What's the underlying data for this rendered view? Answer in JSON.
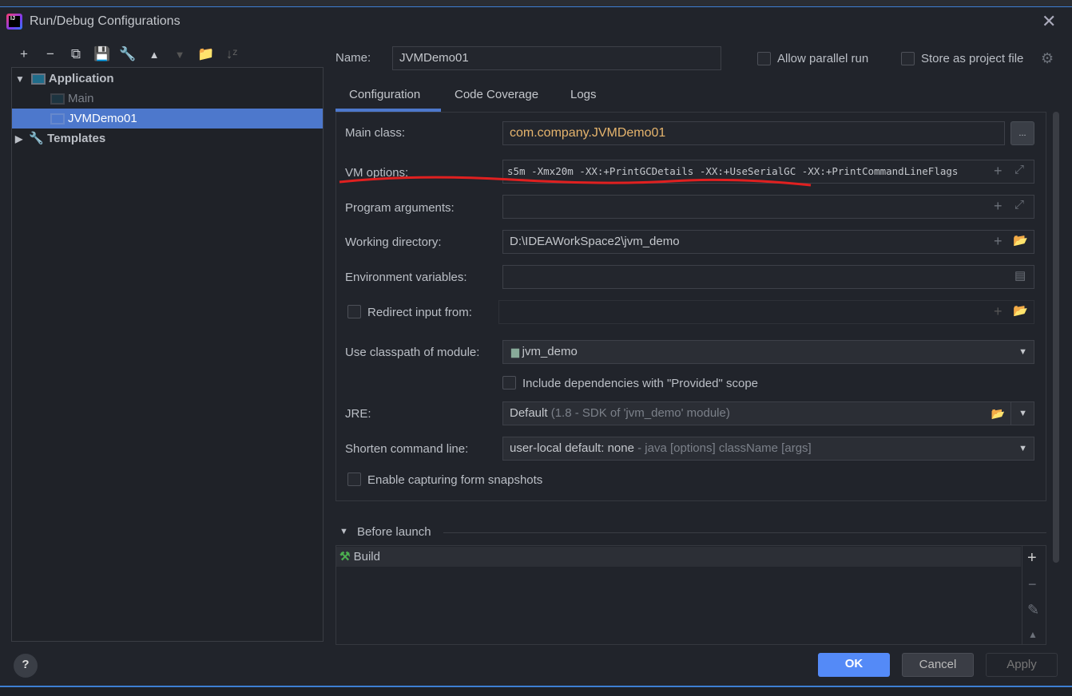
{
  "window": {
    "title": "Run/Debug Configurations"
  },
  "toolbar": [
    "add",
    "remove",
    "copy",
    "save",
    "edit-defaults",
    "move-up",
    "move-down",
    "new-folder",
    "sort"
  ],
  "tree": {
    "items": [
      {
        "label": "Application"
      },
      {
        "label": "Main"
      },
      {
        "label": "JVMDemo01"
      },
      {
        "label": "Templates"
      }
    ]
  },
  "name": {
    "label": "Name:",
    "value": "JVMDemo01"
  },
  "options": {
    "parallel": "Allow parallel run",
    "store": "Store as project file"
  },
  "tabs": [
    "Configuration",
    "Code Coverage",
    "Logs"
  ],
  "form": {
    "main_class_label": "Main class:",
    "main_class": "com.company.JVMDemo01",
    "browse": "...",
    "vm_label": "VM options:",
    "vm_value": "s5m -Xmx20m -XX:+PrintGCDetails -XX:+UseSerialGC -XX:+PrintCommandLineFlags",
    "args_label": "Program arguments:",
    "wd_label": "Working directory:",
    "wd_value": "D:\\IDEAWorkSpace2\\jvm_demo",
    "env_label": "Environment variables:",
    "redirect_label": "Redirect input from:",
    "classpath_label": "Use classpath of module:",
    "classpath_value": "jvm_demo",
    "provided_label": "Include dependencies with \"Provided\" scope",
    "jre_label": "JRE:",
    "jre_value": "Default",
    "jre_hint": "(1.8 - SDK of 'jvm_demo' module)",
    "shorten_label": "Shorten command line:",
    "shorten_value": "user-local default: none",
    "shorten_hint": "- java [options] className [args]",
    "snapshots_label": "Enable capturing form snapshots"
  },
  "before_launch": {
    "title": "Before launch",
    "items": [
      "Build"
    ]
  },
  "buttons": {
    "ok": "OK",
    "cancel": "Cancel",
    "apply": "Apply",
    "help": "?"
  },
  "colors": {
    "accent": "#4d78cc",
    "ok": "#548af7",
    "main_class": "#e5b46d",
    "annotation": "#e02020"
  }
}
